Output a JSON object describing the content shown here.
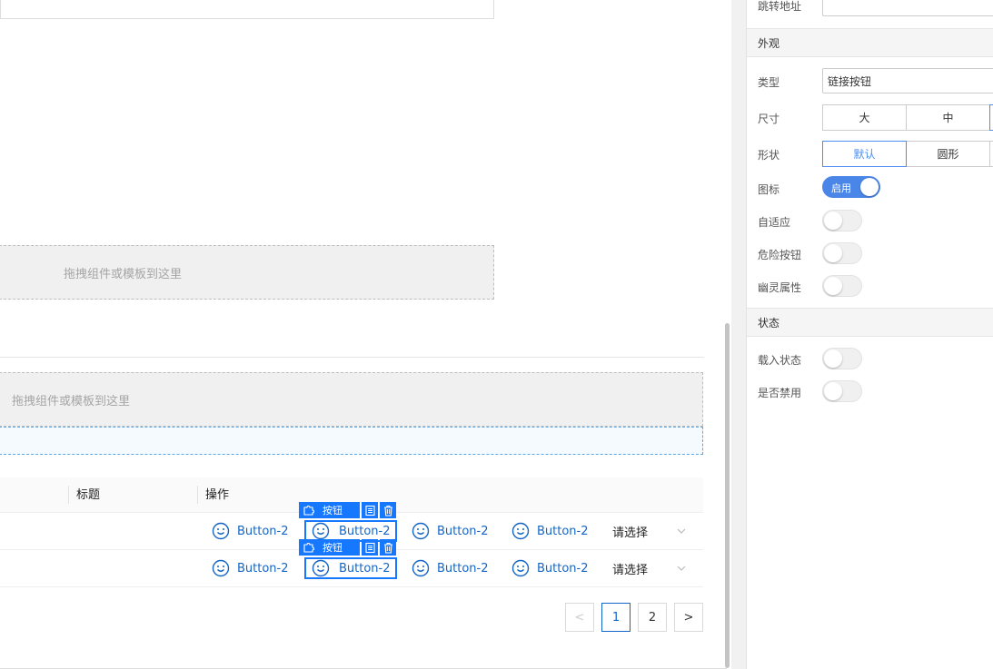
{
  "canvas": {
    "drop_zone_1": "拖拽组件或模板到这里",
    "drop_zone_2": "拖拽组件或模板到这里",
    "table": {
      "headers": [
        "标题",
        "操作"
      ],
      "rows": [
        {
          "buttons": [
            "Button-2",
            "Button-2",
            "Button-2",
            "Button-2"
          ],
          "select": "请选择"
        },
        {
          "buttons": [
            "Button-2",
            "Button-2",
            "Button-2",
            "Button-2"
          ],
          "select": "请选择"
        }
      ],
      "selected_toolbar_label": "按钮"
    },
    "pagination": {
      "prev": "<",
      "pages": [
        "1",
        "2"
      ],
      "current": "1",
      "next": ">"
    }
  },
  "panel": {
    "jump_label": "跳转地址",
    "jump_value": "",
    "section_appearance": "外观",
    "type_label": "类型",
    "type_value": "链接按钮",
    "size_label": "尺寸",
    "size_options": [
      "大",
      "中"
    ],
    "shape_label": "形状",
    "shape_options": [
      "默认",
      "圆形"
    ],
    "shape_selected": "默认",
    "icon_label": "图标",
    "icon_switch_text": "启用",
    "icon_enabled": true,
    "adaptive_label": "自适应",
    "adaptive_enabled": false,
    "danger_label": "危险按钮",
    "danger_enabled": false,
    "ghost_label": "幽灵属性",
    "ghost_enabled": false,
    "section_state": "状态",
    "loading_label": "载入状态",
    "loading_enabled": false,
    "disabled_label": "是否禁用",
    "disabled_enabled": false
  },
  "colors": {
    "accent": "#1677ff",
    "link": "#1465c7",
    "switch_on": "#4a86e8"
  }
}
